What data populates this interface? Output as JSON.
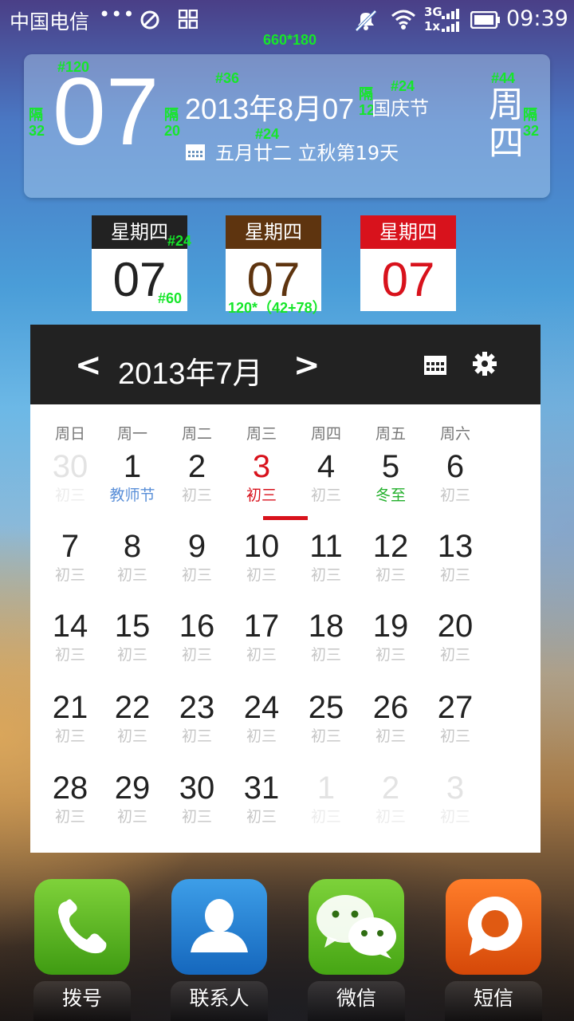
{
  "status_bar": {
    "carrier": "中国电信",
    "dots": "•••",
    "network_label_top": "3G",
    "network_label_bottom": "1x",
    "time": "09:39"
  },
  "annotations": {
    "widget_size": "660*180",
    "big_size": "#120",
    "gap_left": "隔\n32",
    "gap_mid": "隔\n20",
    "date_size": "#36",
    "festival_gap": "隔\n12",
    "festival_size": "#24",
    "lunar_size": "#24",
    "weekday_size": "#44",
    "gap_right": "隔\n32",
    "mini_head_size": "#24",
    "mini_num_size": "#60",
    "mini_dims": "120*（42+78）"
  },
  "date_widget": {
    "big_day": "07",
    "full_date": "2013年8月07",
    "festival": "国庆节",
    "lunar": "五月廿二  立秋第19天",
    "weekday_vertical": "周四"
  },
  "mini_widgets": [
    {
      "weekday": "星期四",
      "day": "07"
    },
    {
      "weekday": "星期四",
      "day": "07"
    },
    {
      "weekday": "星期四",
      "day": "07"
    }
  ],
  "calendar": {
    "prev": "<",
    "month_title": "2013年7月",
    "next": ">",
    "weekdays": [
      "周日",
      "周一",
      "周二",
      "周三",
      "周四",
      "周五",
      "周六"
    ],
    "rows": [
      [
        {
          "d": "30",
          "l": "初三",
          "faded": true
        },
        {
          "d": "1",
          "l": "教师节",
          "lc": "#5a8fd8"
        },
        {
          "d": "2",
          "l": "初三"
        },
        {
          "d": "3",
          "l": "初三",
          "today": true
        },
        {
          "d": "4",
          "l": "初三"
        },
        {
          "d": "5",
          "l": "冬至",
          "lc": "#23b02c"
        },
        {
          "d": "6",
          "l": "初三"
        }
      ],
      [
        {
          "d": "7",
          "l": "初三"
        },
        {
          "d": "8",
          "l": "初三"
        },
        {
          "d": "9",
          "l": "初三"
        },
        {
          "d": "10",
          "l": "初三"
        },
        {
          "d": "11",
          "l": "初三"
        },
        {
          "d": "12",
          "l": "初三"
        },
        {
          "d": "13",
          "l": "初三"
        }
      ],
      [
        {
          "d": "14",
          "l": "初三"
        },
        {
          "d": "15",
          "l": "初三"
        },
        {
          "d": "16",
          "l": "初三"
        },
        {
          "d": "17",
          "l": "初三"
        },
        {
          "d": "18",
          "l": "初三"
        },
        {
          "d": "19",
          "l": "初三"
        },
        {
          "d": "20",
          "l": "初三"
        }
      ],
      [
        {
          "d": "21",
          "l": "初三"
        },
        {
          "d": "22",
          "l": "初三"
        },
        {
          "d": "23",
          "l": "初三"
        },
        {
          "d": "24",
          "l": "初三"
        },
        {
          "d": "25",
          "l": "初三"
        },
        {
          "d": "26",
          "l": "初三"
        },
        {
          "d": "27",
          "l": "初三"
        }
      ],
      [
        {
          "d": "28",
          "l": "初三"
        },
        {
          "d": "29",
          "l": "初三"
        },
        {
          "d": "30",
          "l": "初三"
        },
        {
          "d": "31",
          "l": "初三"
        },
        {
          "d": "1",
          "l": "初三",
          "faded": true
        },
        {
          "d": "2",
          "l": "初三",
          "faded": true
        },
        {
          "d": "3",
          "l": "初三",
          "faded": true
        }
      ]
    ],
    "today_color": "#d8121c"
  },
  "dock": [
    {
      "label": "拨号",
      "icon": "phone-icon"
    },
    {
      "label": "联系人",
      "icon": "contacts-icon"
    },
    {
      "label": "微信",
      "icon": "wechat-icon"
    },
    {
      "label": "短信",
      "icon": "sms-icon"
    }
  ]
}
